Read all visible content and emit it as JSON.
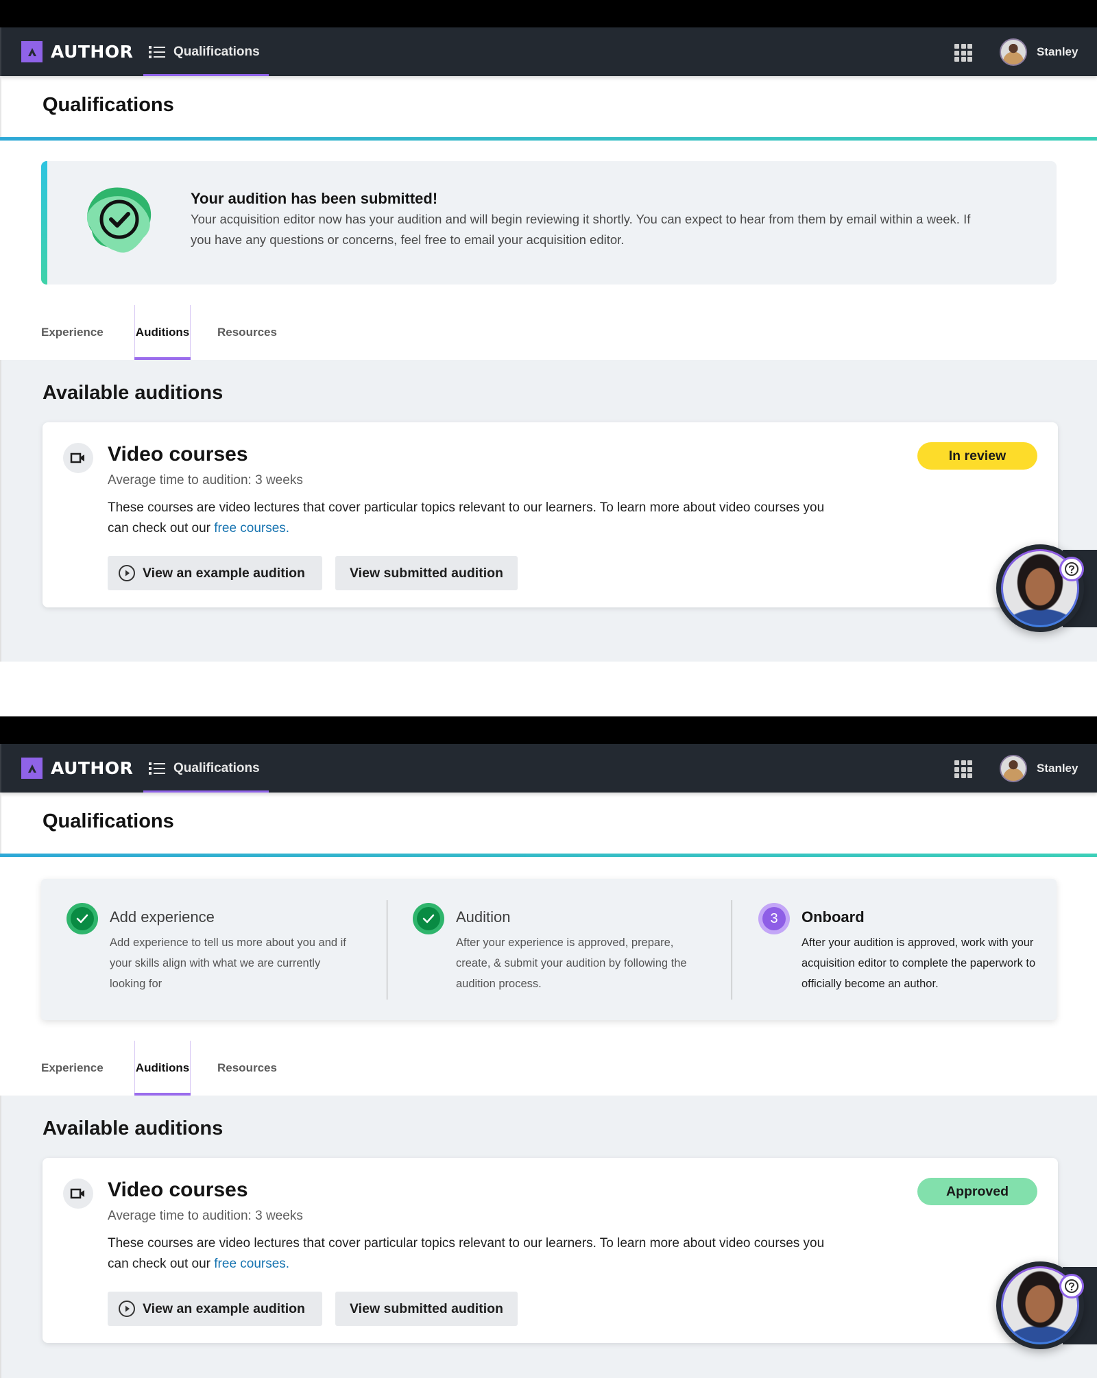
{
  "app": {
    "logo_text": "AUTHOR",
    "nav_tab_label": "Qualifications",
    "user_name": "Stanley",
    "accent_color": "#8f63e8"
  },
  "screens": [
    {
      "page_title": "Qualifications",
      "banner": {
        "title": "Your audition has been submitted!",
        "text": "Your acquisition editor now has your audition and will begin reviewing it shortly. You can expect to hear from them by email within a week. If you have any questions or concerns, feel free to email your acquisition editor."
      },
      "tabs": [
        {
          "label": "Experience",
          "active": false
        },
        {
          "label": "Auditions",
          "active": true
        },
        {
          "label": "Resources",
          "active": false
        }
      ],
      "section_title": "Available auditions",
      "audition": {
        "title": "Video courses",
        "subtitle": "Average time to audition: 3 weeks",
        "description": "These courses are video lectures that cover particular topics relevant to our learners. To learn more about video courses you can check out our ",
        "link_text": "free courses.",
        "status": "In review",
        "status_color": "#fddc2a",
        "button_example": "View an example audition",
        "button_submitted": "View submitted audition"
      }
    },
    {
      "page_title": "Qualifications",
      "steps": [
        {
          "number": "1",
          "title": "Add experience",
          "description": "Add experience to tell us more about you and if your skills align with what we are currently looking for",
          "state": "done"
        },
        {
          "number": "2",
          "title": "Audition",
          "description": "After your experience is approved, prepare, create, & submit your audition by following the audition process.",
          "state": "done"
        },
        {
          "number": "3",
          "title": "Onboard",
          "description": "After your audition is approved, work with your acquisition editor to complete the paperwork to officially become an author.",
          "state": "current"
        }
      ],
      "tabs": [
        {
          "label": "Experience",
          "active": false
        },
        {
          "label": "Auditions",
          "active": true
        },
        {
          "label": "Resources",
          "active": false
        }
      ],
      "section_title": "Available auditions",
      "audition": {
        "title": "Video courses",
        "subtitle": "Average time to audition: 3 weeks",
        "description": "These courses are video lectures that cover particular topics relevant to our learners. To learn more about video courses you can check out our ",
        "link_text": "free courses.",
        "status": "Approved",
        "status_color": "#82e0ac",
        "button_example": "View an example audition",
        "button_submitted": "View submitted audition"
      }
    }
  ]
}
